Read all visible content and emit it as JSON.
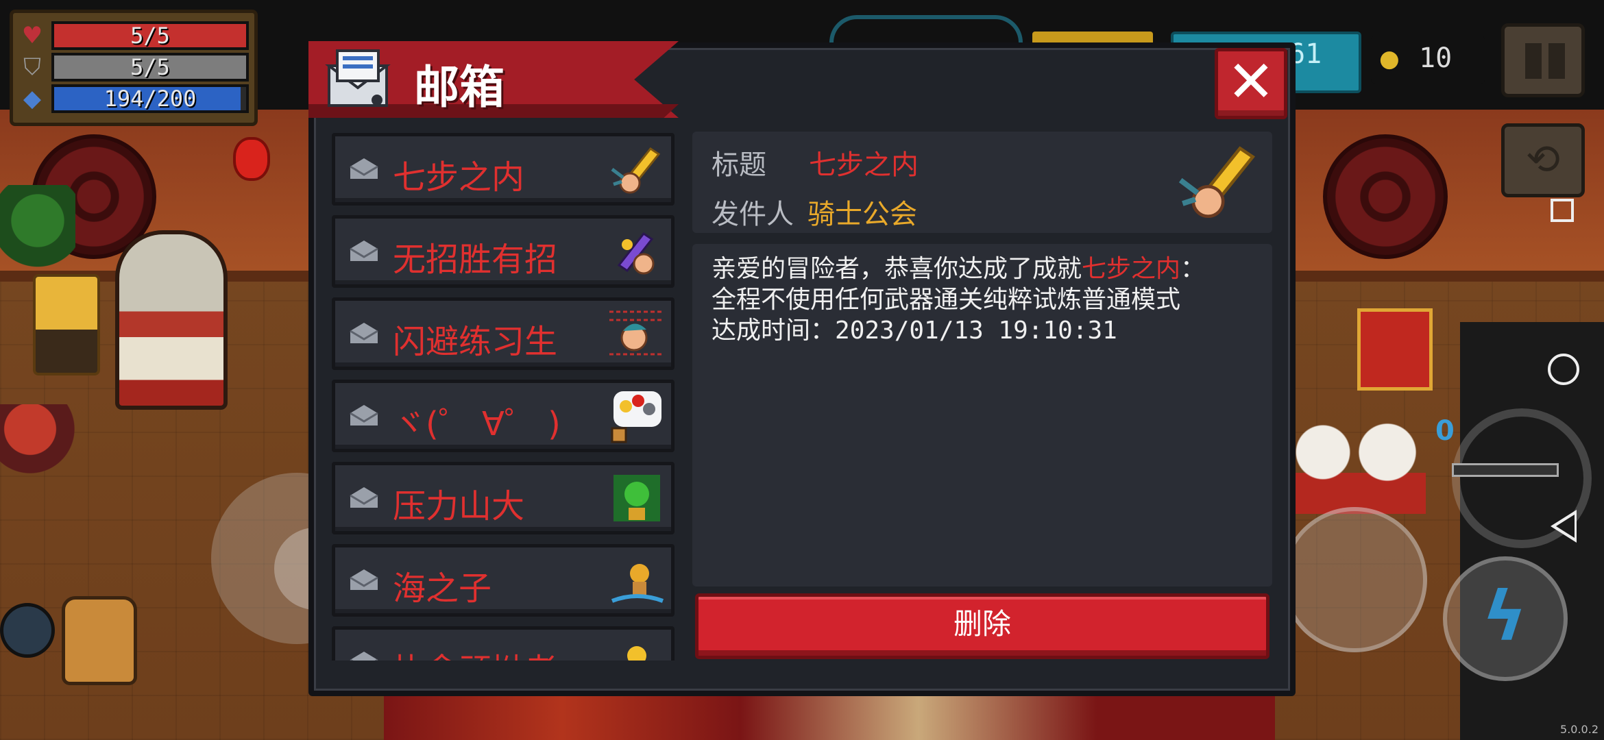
{
  "hud": {
    "hp": "5/5",
    "armor": "5/5",
    "energy": "194/200",
    "hp_fraction": 1.0,
    "armor_fraction": 1.0,
    "energy_fraction": 0.97,
    "icons": {
      "hp": "heart-icon",
      "armor": "shield-icon",
      "energy": "diamond-icon"
    }
  },
  "top_right": {
    "gems": "61",
    "gold": "10"
  },
  "mailbox": {
    "title": "邮箱",
    "close_label": "✕",
    "items": [
      {
        "name": "七步之内",
        "icon": "sword-hand-icon"
      },
      {
        "name": "无招胜有招",
        "icon": "purple-sword-icon"
      },
      {
        "name": "闪避练习生",
        "icon": "dodging-hero-icon"
      },
      {
        "name": "ヾ(゜ ∀゜ )",
        "icon": "emoji-bubble-icon"
      },
      {
        "name": "压力山大",
        "icon": "green-boss-icon"
      },
      {
        "name": "海之子",
        "icon": "surfer-icon"
      },
      {
        "name": "执念顽拗者",
        "icon": "item-icon"
      }
    ],
    "detail": {
      "title_label": "标题",
      "title_value": "七步之内",
      "sender_label": "发件人",
      "sender_value": "骑士公会",
      "body_prefix": "亲爱的冒险者，恭喜你达成了成就",
      "body_highlight": "七步之内",
      "body_suffix": "：",
      "body_line2": "全程不使用任何武器通关纯粹试炼普通模式",
      "body_time_label": "达成时间：",
      "body_time_value": "2023/01/13 19:10:31"
    },
    "delete_label": "删除"
  },
  "controls": {
    "weapon_cost": "0"
  },
  "version": "5.0.0.2",
  "colors": {
    "accent_red": "#e0302f",
    "sender_gold": "#e9a92a",
    "panel_bg": "#202329"
  }
}
